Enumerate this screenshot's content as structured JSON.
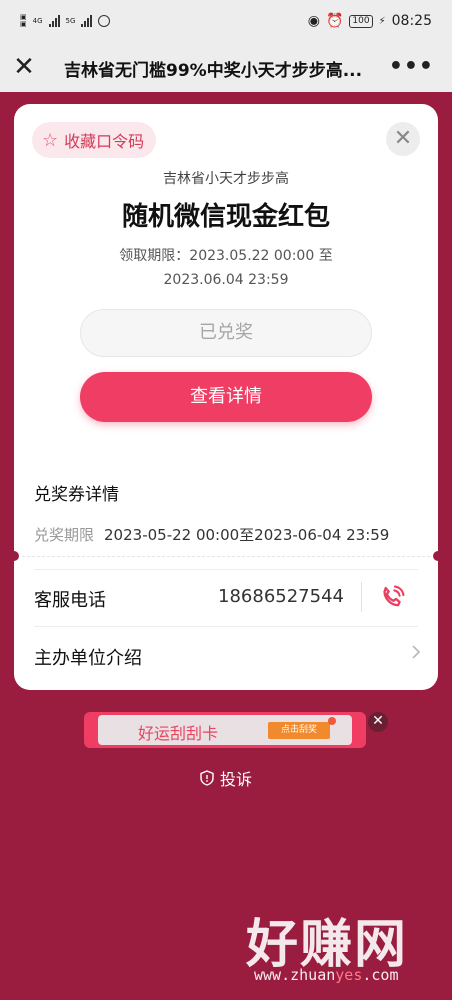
{
  "status_bar": {
    "left_icons": [
      "sim-icon",
      "4g-signal-icon",
      "5g-signal-icon",
      "sync-icon"
    ],
    "network_4g": "4G",
    "network_5g": "5G",
    "right_icons": [
      "eye-icon",
      "alarm-icon",
      "battery-icon",
      "charging-icon"
    ],
    "battery": "100",
    "time": "08:25"
  },
  "nav": {
    "title": "吉林省无门槛99%中奖小天才步步高...",
    "more": "•••"
  },
  "card": {
    "favorite_label": "收藏口令码",
    "close_icon": "close-icon",
    "org_name": "吉林省小天才步步高",
    "prize_title": "随机微信现金红包",
    "period_line1": "领取期限：2023.05.22 00:00 至",
    "period_line2": "2023.06.04 23:59",
    "redeemed_label": "已兑奖",
    "view_details_label": "查看详情",
    "coupon_section_title": "兑奖券详情",
    "redeem_period_label": "兑奖期限",
    "redeem_period_value": "2023-05-22 00:00至2023-06-04 23:59",
    "service_phone_label": "客服电话",
    "service_phone_value": "18686527544",
    "organizer_label": "主办单位介绍"
  },
  "banner": {
    "text": "好运刮刮卡",
    "button": "点击刮奖"
  },
  "complaint_label": "投诉",
  "watermark": {
    "big": "好赚网",
    "small_prefix": "www.zhuan",
    "small_accent": "yes",
    "small_suffix": ".com"
  },
  "colors": {
    "background": "#9a1c3e",
    "accent_red": "#f03d64",
    "favorite_bg": "#fbe8ec"
  }
}
